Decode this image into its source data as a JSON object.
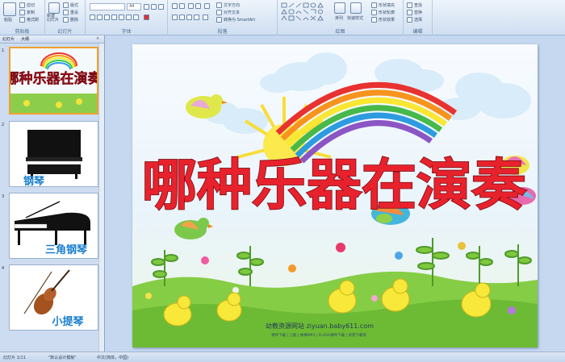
{
  "ribbon": {
    "groups": [
      {
        "label": "剪贴板"
      },
      {
        "label": "幻灯片"
      },
      {
        "label": "字体"
      },
      {
        "label": "段落"
      },
      {
        "label": "绘图"
      },
      {
        "label": "编辑"
      }
    ],
    "clipboard": {
      "paste": "粘贴",
      "cut": "剪切",
      "copy": "复制",
      "format_painter": "格式刷"
    },
    "slides": {
      "new_slide": "新建\n幻灯片",
      "layout": "版式",
      "reset": "重设",
      "delete": "删除"
    },
    "font": {
      "font_size": "44"
    },
    "paragraph": {
      "text_direction": "文字方向",
      "align_text": "对齐文本",
      "smartart": "转换为 SmartArt"
    },
    "drawing": {
      "arrange": "排列",
      "quick_styles": "快速样式",
      "shape_fill": "形状填充",
      "shape_outline": "形状轮廓",
      "shape_effects": "形状效果"
    },
    "editing": {
      "find": "查找",
      "replace": "替换",
      "select": "选择"
    }
  },
  "pane": {
    "tab_slides": "幻灯片",
    "tab_outline": "大纲",
    "thumbnails": [
      {
        "num": "1",
        "caption": "哪种乐器在演奏",
        "selected": true
      },
      {
        "num": "2",
        "caption": "钢琴"
      },
      {
        "num": "3",
        "caption": "三角钢琴"
      },
      {
        "num": "4",
        "caption": "小提琴"
      }
    ]
  },
  "slide": {
    "title": "哪种乐器在演奏",
    "footer_site": "幼教资源网站 ziyuan.baby611.com",
    "footer_links": "课件下载 | 儿歌 | 故事MP3 | FLASH课件下载 | 试卷下载等"
  },
  "status": {
    "slide_count": "幻灯片 1/11",
    "theme": "\"默认设计模板\"",
    "language": "中文(简体，中国)"
  },
  "colors": {
    "title_fill": "#e8222c",
    "title_outline": "#7a0a14",
    "grass": "#7cc23e",
    "ribbon_bg": "#dbe7f5"
  }
}
